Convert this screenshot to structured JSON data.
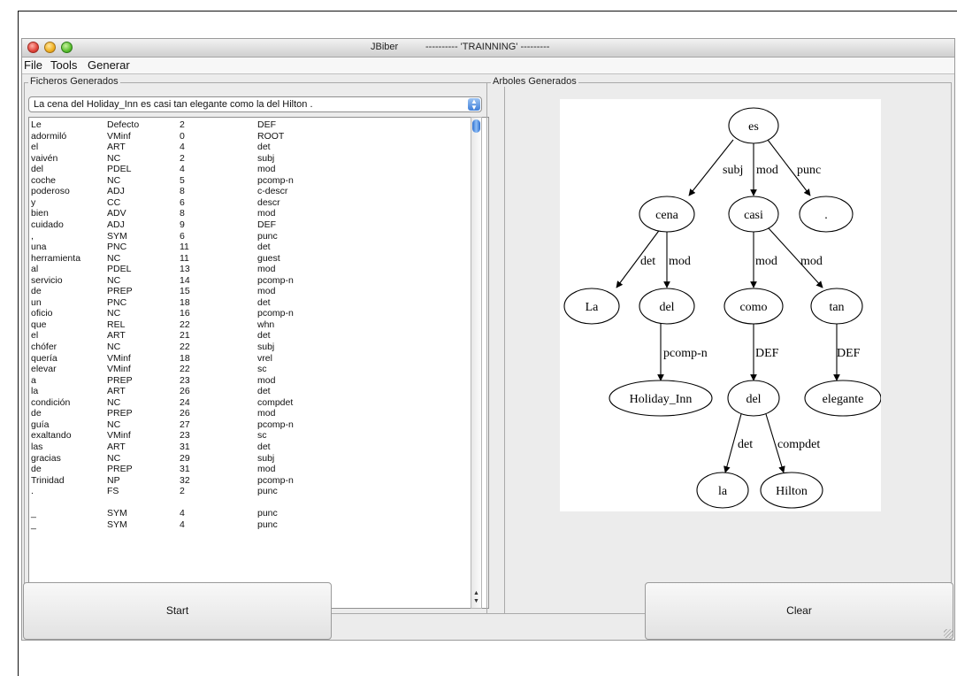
{
  "window": {
    "app_name": "JBiber",
    "mode": "---------- 'TRAINNING' ---------"
  },
  "menu": [
    "File",
    "Tools",
    "Generar"
  ],
  "left_panel": {
    "title": "Ficheros Generados",
    "selected_sentence": "La cena del Holiday_Inn es casi tan elegante como la del Hilton .",
    "rows": [
      [
        "Le",
        "Defecto",
        "2",
        "DEF"
      ],
      [
        "adormiló",
        "VMinf",
        "0",
        "ROOT"
      ],
      [
        "el",
        "ART",
        "4",
        "det"
      ],
      [
        "vaivén",
        "NC",
        "2",
        "subj"
      ],
      [
        "del",
        "PDEL",
        "4",
        "mod"
      ],
      [
        "coche",
        "NC",
        "5",
        "pcomp-n"
      ],
      [
        "poderoso",
        "ADJ",
        "8",
        "c-descr"
      ],
      [
        "y",
        "CC",
        "6",
        "descr"
      ],
      [
        "bien",
        "ADV",
        "8",
        "mod"
      ],
      [
        "cuidado",
        "ADJ",
        "9",
        "DEF"
      ],
      [
        ",",
        "SYM",
        "6",
        "punc"
      ],
      [
        "una",
        "PNC",
        "11",
        "det"
      ],
      [
        "herramienta",
        "NC",
        "11",
        "guest"
      ],
      [
        "al",
        "PDEL",
        "13",
        "mod"
      ],
      [
        "servicio",
        "NC",
        "14",
        "pcomp-n"
      ],
      [
        "de",
        "PREP",
        "15",
        "mod"
      ],
      [
        "un",
        "PNC",
        "18",
        "det"
      ],
      [
        "oficio",
        "NC",
        "16",
        "pcomp-n"
      ],
      [
        "que",
        "REL",
        "22",
        "whn"
      ],
      [
        "el",
        "ART",
        "21",
        "det"
      ],
      [
        "chófer",
        "NC",
        "22",
        "subj"
      ],
      [
        "quería",
        "VMinf",
        "18",
        "vrel"
      ],
      [
        "elevar",
        "VMinf",
        "22",
        "sc"
      ],
      [
        "a",
        "PREP",
        "23",
        "mod"
      ],
      [
        "la",
        "ART",
        "26",
        "det"
      ],
      [
        "condición",
        "NC",
        "24",
        "compdet"
      ],
      [
        "de",
        "PREP",
        "26",
        "mod"
      ],
      [
        "guía",
        "NC",
        "27",
        "pcomp-n"
      ],
      [
        "exaltando",
        "VMinf",
        "23",
        "sc"
      ],
      [
        "las",
        "ART",
        "31",
        "det"
      ],
      [
        "gracias",
        "NC",
        "29",
        "subj"
      ],
      [
        "de",
        "PREP",
        "31",
        "mod"
      ],
      [
        "Trinidad",
        "NP",
        "32",
        "pcomp-n"
      ],
      [
        ".",
        "FS",
        "2",
        "punc"
      ],
      [
        "",
        "",
        "",
        ""
      ],
      [
        "_",
        "SYM",
        "4",
        "punc"
      ],
      [
        "_",
        "SYM",
        "4",
        "punc"
      ]
    ]
  },
  "right_panel": {
    "title": "Arboles Generados",
    "tree": {
      "nodes": {
        "es": "es",
        "cena": "cena",
        "casi": "casi",
        "dot": ".",
        "La": "La",
        "del1": "del",
        "como": "como",
        "tan": "tan",
        "holiday": "Holiday_Inn",
        "del2": "del",
        "elegante": "elegante",
        "la": "la",
        "hilton": "Hilton"
      },
      "edges": {
        "subj": "subj",
        "mod_es": "mod",
        "punc": "punc",
        "det_cena": "det",
        "mod_cena": "mod",
        "mod_casi1": "mod",
        "mod_casi2": "mod",
        "pcomp": "pcomp-n",
        "def_como": "DEF",
        "def_tan": "DEF",
        "det_del": "det",
        "compdet": "compdet"
      }
    }
  },
  "buttons": {
    "start": "Start",
    "clear": "Clear"
  }
}
